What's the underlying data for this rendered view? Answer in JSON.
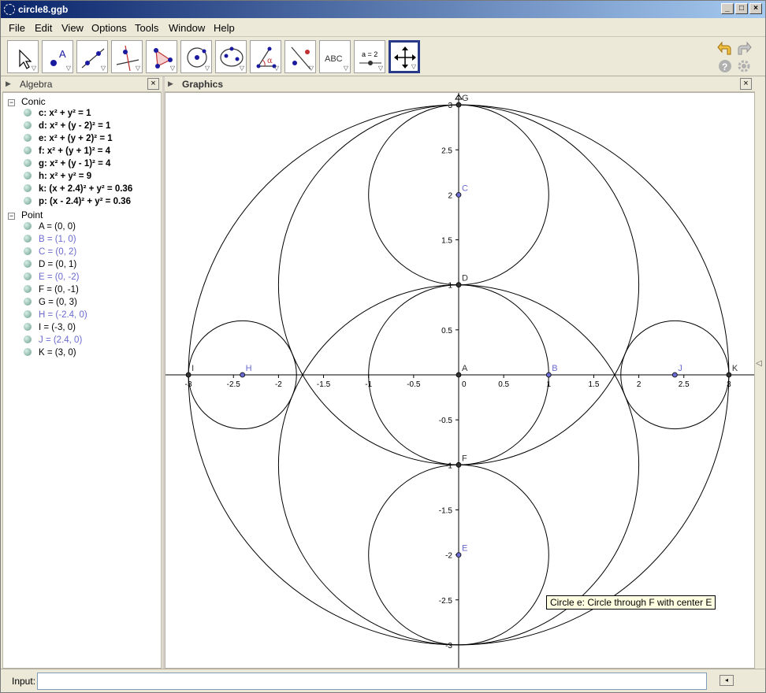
{
  "window": {
    "title": "circle8.ggb"
  },
  "menu": [
    "File",
    "Edit",
    "View",
    "Options",
    "Tools",
    "Window",
    "Help"
  ],
  "toolbar": {
    "tools": [
      "move-tool",
      "point-tool",
      "line-tool",
      "perpendicular-line-tool",
      "polygon-tool",
      "circle-center-point-tool",
      "conic-five-points-tool",
      "angle-tool",
      "reflect-tool",
      "text-tool",
      "slider-tool",
      "move-graphics-view-tool"
    ],
    "text_tool_label": "ABC",
    "slider_tool_label": "a = 2"
  },
  "algebra": {
    "title": "Algebra",
    "groups": [
      {
        "label": "Conic",
        "items": [
          {
            "text": "c: x² + y² = 1",
            "bold": true,
            "color": "#000000"
          },
          {
            "text": "d: x² + (y - 2)² = 1",
            "bold": true,
            "color": "#000000"
          },
          {
            "text": "e: x² + (y + 2)² = 1",
            "bold": true,
            "color": "#000000"
          },
          {
            "text": "f: x² + (y + 1)² = 4",
            "bold": true,
            "color": "#000000"
          },
          {
            "text": "g: x² + (y - 1)² = 4",
            "bold": true,
            "color": "#000000"
          },
          {
            "text": "h: x² + y² = 9",
            "bold": true,
            "color": "#000000"
          },
          {
            "text": "k: (x + 2.4)² + y² = 0.36",
            "bold": true,
            "color": "#000000"
          },
          {
            "text": "p: (x - 2.4)² + y² = 0.36",
            "bold": true,
            "color": "#000000"
          }
        ]
      },
      {
        "label": "Point",
        "items": [
          {
            "text": "A = (0, 0)",
            "bold": false,
            "color": "#000000"
          },
          {
            "text": "B = (1, 0)",
            "bold": false,
            "color": "#6a6ad0"
          },
          {
            "text": "C = (0, 2)",
            "bold": false,
            "color": "#6a6ad0"
          },
          {
            "text": "D = (0, 1)",
            "bold": false,
            "color": "#000000"
          },
          {
            "text": "E = (0, -2)",
            "bold": false,
            "color": "#6a6ad0"
          },
          {
            "text": "F = (0, -1)",
            "bold": false,
            "color": "#000000"
          },
          {
            "text": "G = (0, 3)",
            "bold": false,
            "color": "#000000"
          },
          {
            "text": "H = (-2.4, 0)",
            "bold": false,
            "color": "#6a6ad0"
          },
          {
            "text": "I = (-3, 0)",
            "bold": false,
            "color": "#000000"
          },
          {
            "text": "J = (2.4, 0)",
            "bold": false,
            "color": "#6a6ad0"
          },
          {
            "text": "K = (3, 0)",
            "bold": false,
            "color": "#000000"
          }
        ]
      }
    ]
  },
  "graphics": {
    "title": "Graphics",
    "x_ticks": [
      "-3",
      "-2.5",
      "-2",
      "-1.5",
      "-1",
      "-0.5",
      "0",
      "0.5",
      "1",
      "1.5",
      "2",
      "2.5",
      "3"
    ],
    "y_ticks": [
      "3",
      "2.5",
      "2",
      "1.5",
      "1",
      "0.5",
      "0",
      "-0.5",
      "-1",
      "-1.5",
      "-2",
      "-2.5",
      "-3"
    ],
    "circles": [
      {
        "name": "c",
        "cx": 0,
        "cy": 0,
        "r": 1
      },
      {
        "name": "d",
        "cx": 0,
        "cy": 2,
        "r": 1
      },
      {
        "name": "e",
        "cx": 0,
        "cy": -2,
        "r": 1
      },
      {
        "name": "f",
        "cx": 0,
        "cy": -1,
        "r": 2
      },
      {
        "name": "g",
        "cx": 0,
        "cy": 1,
        "r": 2
      },
      {
        "name": "h",
        "cx": 0,
        "cy": 0,
        "r": 3
      },
      {
        "name": "k",
        "cx": -2.4,
        "cy": 0,
        "r": 0.6
      },
      {
        "name": "p",
        "cx": 2.4,
        "cy": 0,
        "r": 0.6
      }
    ],
    "points": [
      {
        "label": "A",
        "x": 0,
        "y": 0,
        "free": false
      },
      {
        "label": "B",
        "x": 1,
        "y": 0,
        "free": true
      },
      {
        "label": "C",
        "x": 0,
        "y": 2,
        "free": true
      },
      {
        "label": "D",
        "x": 0,
        "y": 1,
        "free": false
      },
      {
        "label": "E",
        "x": 0,
        "y": -2,
        "free": true
      },
      {
        "label": "F",
        "x": 0,
        "y": -1,
        "free": false
      },
      {
        "label": "G",
        "x": 0,
        "y": 3,
        "free": false
      },
      {
        "label": "H",
        "x": -2.4,
        "y": 0,
        "free": true
      },
      {
        "label": "I",
        "x": -3,
        "y": 0,
        "free": false
      },
      {
        "label": "J",
        "x": 2.4,
        "y": 0,
        "free": true
      },
      {
        "label": "K",
        "x": 3,
        "y": 0,
        "free": false
      }
    ],
    "tooltip": "Circle e: Circle through F with center E"
  },
  "input": {
    "label": "Input:",
    "value": ""
  },
  "colors": {
    "free_point": "#6a6ad0",
    "fixed_point": "#333333",
    "title_start": "#0a246a",
    "title_end": "#a6caf0"
  }
}
